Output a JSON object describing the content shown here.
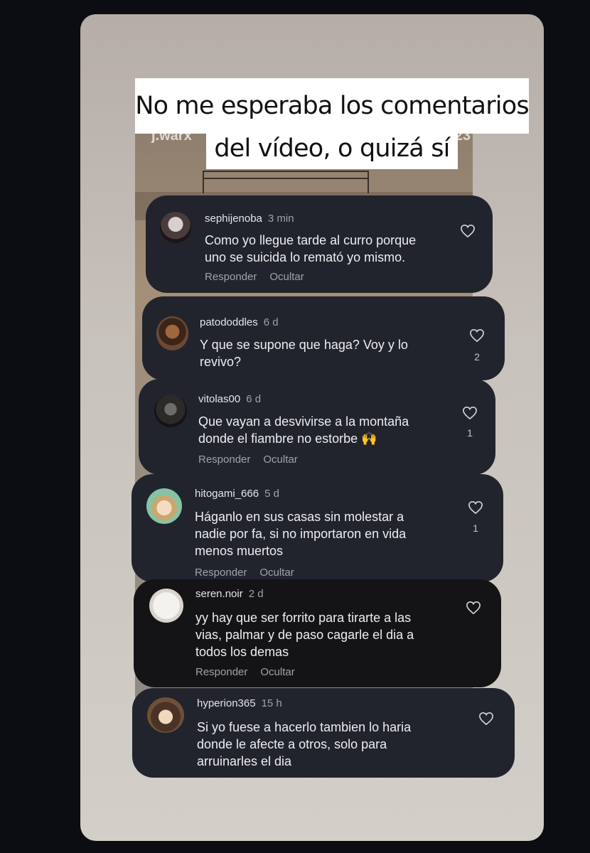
{
  "story": {
    "caption_line1": "No me esperaba los comentarios",
    "caption_line2": "del vídeo, o quizá sí",
    "video_user": "j.warx",
    "video_time": "0:23"
  },
  "comments": [
    {
      "user": "sephijenoba",
      "time": "3 min",
      "text_lines": [
        "Como yo llegue tarde al curro porque",
        "uno se suicida lo remató yo mismo."
      ],
      "reply": "Responder",
      "hide": "Ocultar",
      "likes": ""
    },
    {
      "user": "patododdles",
      "time": "6 d",
      "text_lines": [
        "Y que se supone que haga? Voy y lo",
        "revivo?"
      ],
      "reply": "",
      "hide": "",
      "likes": "2"
    },
    {
      "user": "vitolas00",
      "time": "6 d",
      "text_lines": [
        "Que vayan a desvivirse a la montaña",
        "donde el fiambre no estorbe 🙌"
      ],
      "reply": "Responder",
      "hide": "Ocultar",
      "likes": "1"
    },
    {
      "user": "hitogami_666",
      "time": "5 d",
      "text_lines": [
        "Háganlo en sus casas sin molestar a",
        "nadie por fa, si no importaron en vida",
        "menos muertos"
      ],
      "reply": "Responder",
      "hide": "Ocultar",
      "likes": "1"
    },
    {
      "user": "seren.noir",
      "time": "2 d",
      "text_lines": [
        "yy hay que ser forrito para tirarte a las",
        "vias, palmar y de paso cagarle el dia a",
        "todos los demas"
      ],
      "reply": "Responder",
      "hide": "Ocultar",
      "likes": ""
    },
    {
      "user": "hyperion365",
      "time": "15 h",
      "text_lines": [
        "Si yo fuese a hacerlo tambien lo haria",
        "donde le afecte a otros, solo para",
        "arruinarles el dia"
      ],
      "reply": "",
      "hide": "",
      "likes": ""
    }
  ],
  "colors": {
    "bubble": "#21242c",
    "bubble_dark": "#141417",
    "card": "#c8c2bc",
    "page": "#0b0d12"
  }
}
